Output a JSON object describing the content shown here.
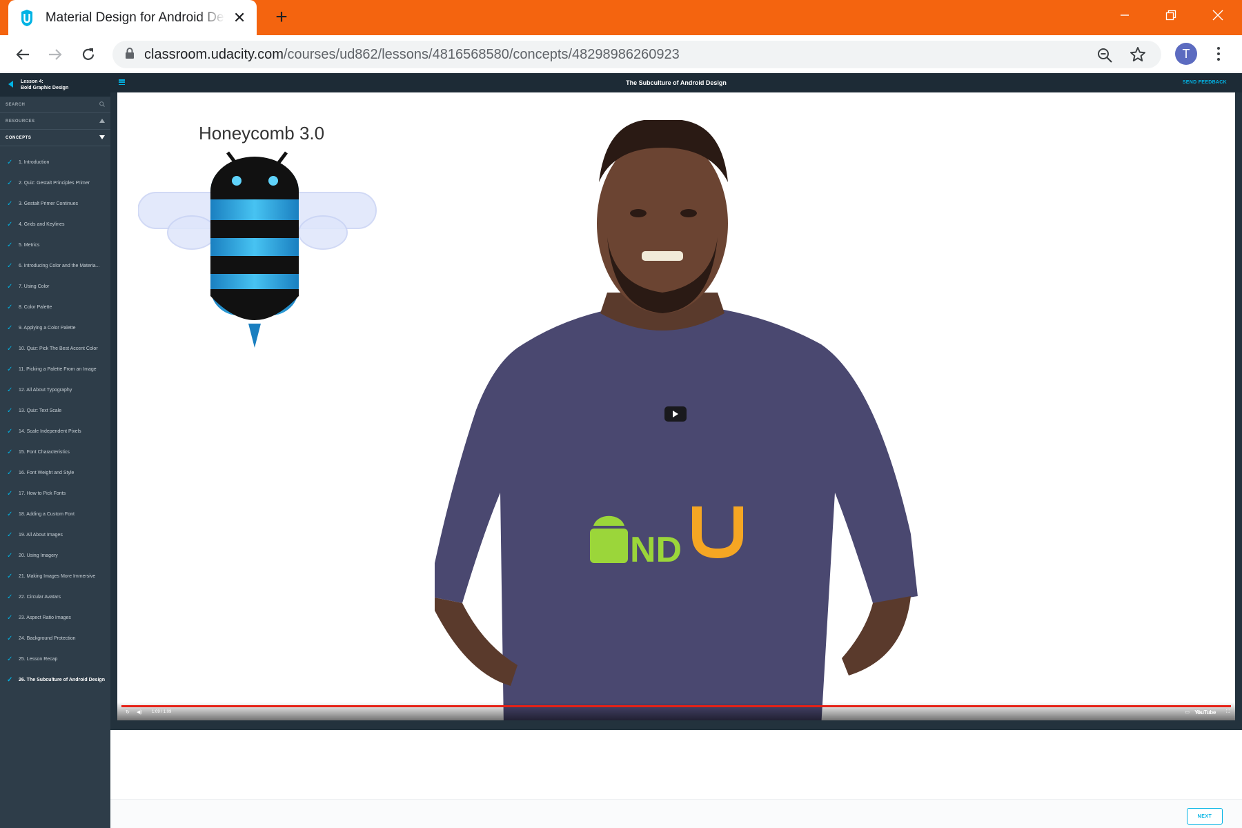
{
  "browser": {
    "tab_title": "Material Design for Android Developers | Udacity",
    "url_host": "classroom.udacity.com",
    "url_path": "/courses/ud862/lessons/4816568580/concepts/48298986260923",
    "avatar_letter": "T",
    "accent": "#f4640f"
  },
  "sidebar": {
    "lesson_label": "Lesson 4:",
    "lesson_name": "Bold Graphic Design",
    "search_label": "SEARCH",
    "resources_label": "RESOURCES",
    "concepts_label": "CONCEPTS",
    "concepts": [
      "1. Introduction",
      "2. Quiz: Gestalt Principles Primer",
      "3. Gestalt Primer Continues",
      "4. Grids and Keylines",
      "5. Metrics",
      "6. Introducing Color and the Materia...",
      "7. Using Color",
      "8. Color Palette",
      "9. Applying a Color Palette",
      "10. Quiz: Pick The Best Accent Color",
      "11. Picking a Palette From an Image",
      "12. All About Typography",
      "13. Quiz: Text Scale",
      "14. Scale Independent Pixels",
      "15. Font Characteristics",
      "16. Font Weight and Style",
      "17. How to Pick Fonts",
      "18. Adding a Custom Font",
      "19. All About Images",
      "20. Using Imagery",
      "21. Making Images More Immersive",
      "22. Circular Avatars",
      "23. Aspect Ratio Images",
      "24. Background Protection",
      "25. Lesson Recap",
      "26. The Subculture of Android Design"
    ],
    "current_index": 25
  },
  "topbar": {
    "title": "The Subculture of Android Design",
    "feedback_label": "SEND FEEDBACK"
  },
  "video": {
    "slide_title": "Honeycomb 3.0",
    "shirt_text": "ND",
    "time": "1:09 / 1:09",
    "brand": "YouTube",
    "progress": 1.0
  },
  "footer": {
    "next_label": "NEXT"
  }
}
